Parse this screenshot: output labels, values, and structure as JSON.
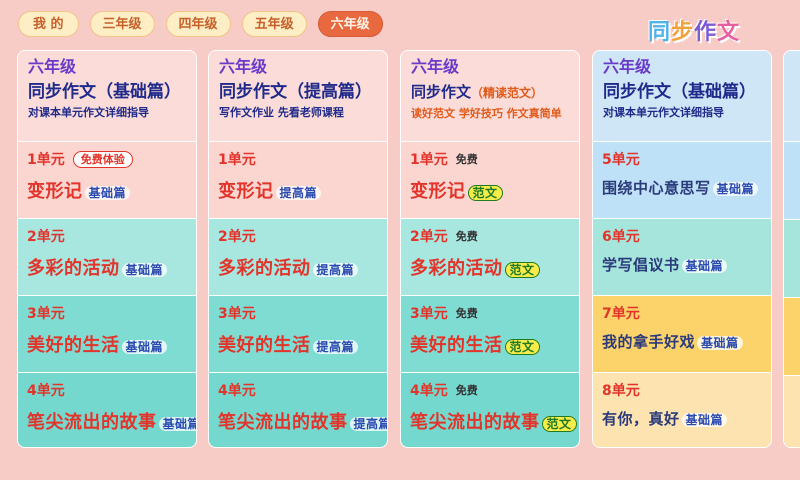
{
  "tabs": [
    "我 的",
    "三年级",
    "四年级",
    "五年级",
    "六年级"
  ],
  "active_tab": "六年级",
  "logo": [
    "同",
    "步",
    "作",
    "文"
  ],
  "colors": {
    "accent": "#e8683f",
    "unit_red": "#e2342a",
    "navy": "#1f2a8a",
    "purple": "#6a3bc9"
  },
  "cards": [
    {
      "grade": "六年级",
      "book": "同步作文",
      "edition": "（基础篇）",
      "subtitle": "对课本单元作文详细指导",
      "units": [
        {
          "num": "1单元",
          "free": "免费体验",
          "title": "变形记",
          "tag": "基础篇"
        },
        {
          "num": "2单元",
          "free": "",
          "title": "多彩的活动",
          "tag": "基础篇"
        },
        {
          "num": "3单元",
          "free": "",
          "title": "美好的生活",
          "tag": "基础篇"
        },
        {
          "num": "4单元",
          "free": "",
          "title": "笔尖流出的故事",
          "tag": "基础篇"
        }
      ]
    },
    {
      "grade": "六年级",
      "book": "同步作文",
      "edition": "（提高篇）",
      "subtitle": "写作文作业 先看老师课程",
      "units": [
        {
          "num": "1单元",
          "free": "",
          "title": "变形记",
          "tag": "提高篇"
        },
        {
          "num": "2单元",
          "free": "",
          "title": "多彩的活动",
          "tag": "提高篇"
        },
        {
          "num": "3单元",
          "free": "",
          "title": "美好的生活",
          "tag": "提高篇"
        },
        {
          "num": "4单元",
          "free": "",
          "title": "笔尖流出的故事",
          "tag": "提高篇"
        }
      ]
    },
    {
      "grade": "六年级",
      "book": "同步作文",
      "edition": "（精读范文）",
      "subtitle": "读好范文 学好技巧 作文真简单",
      "units": [
        {
          "num": "1单元",
          "free": "免费",
          "title": "变形记",
          "tag": "范文"
        },
        {
          "num": "2单元",
          "free": "免费",
          "title": "多彩的活动",
          "tag": "范文"
        },
        {
          "num": "3单元",
          "free": "免费",
          "title": "美好的生活",
          "tag": "范文"
        },
        {
          "num": "4单元",
          "free": "免费",
          "title": "笔尖流出的故事",
          "tag": "范文"
        }
      ]
    },
    {
      "grade": "六年级",
      "book": "同步作文",
      "edition": "（基础篇）",
      "subtitle": "对课本单元作文详细指导",
      "units": [
        {
          "num": "5单元",
          "free": "",
          "title": "围绕中心意思写",
          "tag": "基础篇"
        },
        {
          "num": "6单元",
          "free": "",
          "title": "学写倡议书",
          "tag": "基础篇"
        },
        {
          "num": "7单元",
          "free": "",
          "title": "我的拿手好戏",
          "tag": "基础篇"
        },
        {
          "num": "8单元",
          "free": "",
          "title": "有你，真好",
          "tag": "基础篇"
        }
      ]
    }
  ]
}
